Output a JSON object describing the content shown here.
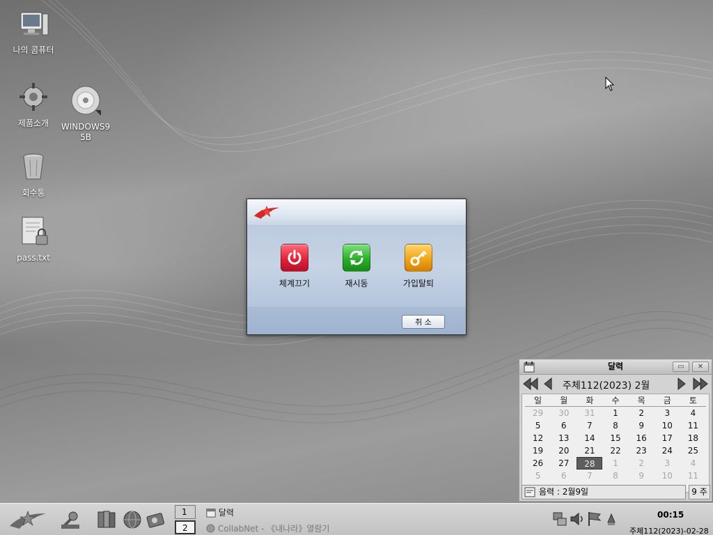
{
  "desktop": {
    "icons": [
      {
        "label": "나의 콤퓨터"
      },
      {
        "label": "제품소개"
      },
      {
        "label": "WINDOWS95B"
      },
      {
        "label": "회수통"
      },
      {
        "label": "pass.txt"
      }
    ]
  },
  "dialog": {
    "actions": [
      {
        "label": "체계끄기",
        "color": "#e0243a"
      },
      {
        "label": "재시동",
        "color": "#2bb02b"
      },
      {
        "label": "가입탈퇴",
        "color": "#f2a51a"
      }
    ],
    "cancel_label": "취   소"
  },
  "calendar": {
    "title": "달력",
    "month_label": "주체112(2023)  2월",
    "weekdays": [
      "일",
      "월",
      "화",
      "수",
      "목",
      "금",
      "토"
    ],
    "weeks": [
      [
        "29",
        "30",
        "31",
        "1",
        "2",
        "3",
        "4"
      ],
      [
        "5",
        "6",
        "7",
        "8",
        "9",
        "10",
        "11"
      ],
      [
        "12",
        "13",
        "14",
        "15",
        "16",
        "17",
        "18"
      ],
      [
        "19",
        "20",
        "21",
        "22",
        "23",
        "24",
        "25"
      ],
      [
        "26",
        "27",
        "28",
        "1",
        "2",
        "3",
        "4"
      ],
      [
        "5",
        "6",
        "7",
        "8",
        "9",
        "10",
        "11"
      ]
    ],
    "lunar": "음력 : 2월9일",
    "week_num": "9 주"
  },
  "taskbar": {
    "pagers": [
      "1",
      "2"
    ],
    "tasks": [
      {
        "label": "달력"
      },
      {
        "label": "CollabNet - 《내나라》열람기"
      }
    ],
    "clock_time": "00:15",
    "clock_date": "주체112(2023)-02-28"
  }
}
